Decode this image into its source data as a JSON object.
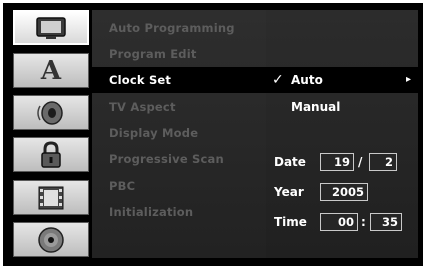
{
  "icons": [
    {
      "name": "disc-icon"
    },
    {
      "name": "language-icon",
      "glyph": "A"
    },
    {
      "name": "speaker-icon"
    },
    {
      "name": "lock-icon"
    },
    {
      "name": "film-icon"
    },
    {
      "name": "cd-icon"
    }
  ],
  "menu": {
    "items": [
      "Auto Programming",
      "Program Edit",
      "Clock Set",
      "TV Aspect",
      "Display Mode",
      "Progressive Scan",
      "PBC",
      "Initialization"
    ],
    "selected": "Clock Set"
  },
  "options": {
    "auto": {
      "check": "✓",
      "label": "Auto",
      "arrow": "▸"
    },
    "manual": "Manual"
  },
  "clock": {
    "date_label": "Date",
    "day": "19",
    "date_sep": "/",
    "month": "2",
    "year_label": "Year",
    "year": "2005",
    "time_label": "Time",
    "hour": "00",
    "time_sep": ":",
    "minute": "35"
  }
}
